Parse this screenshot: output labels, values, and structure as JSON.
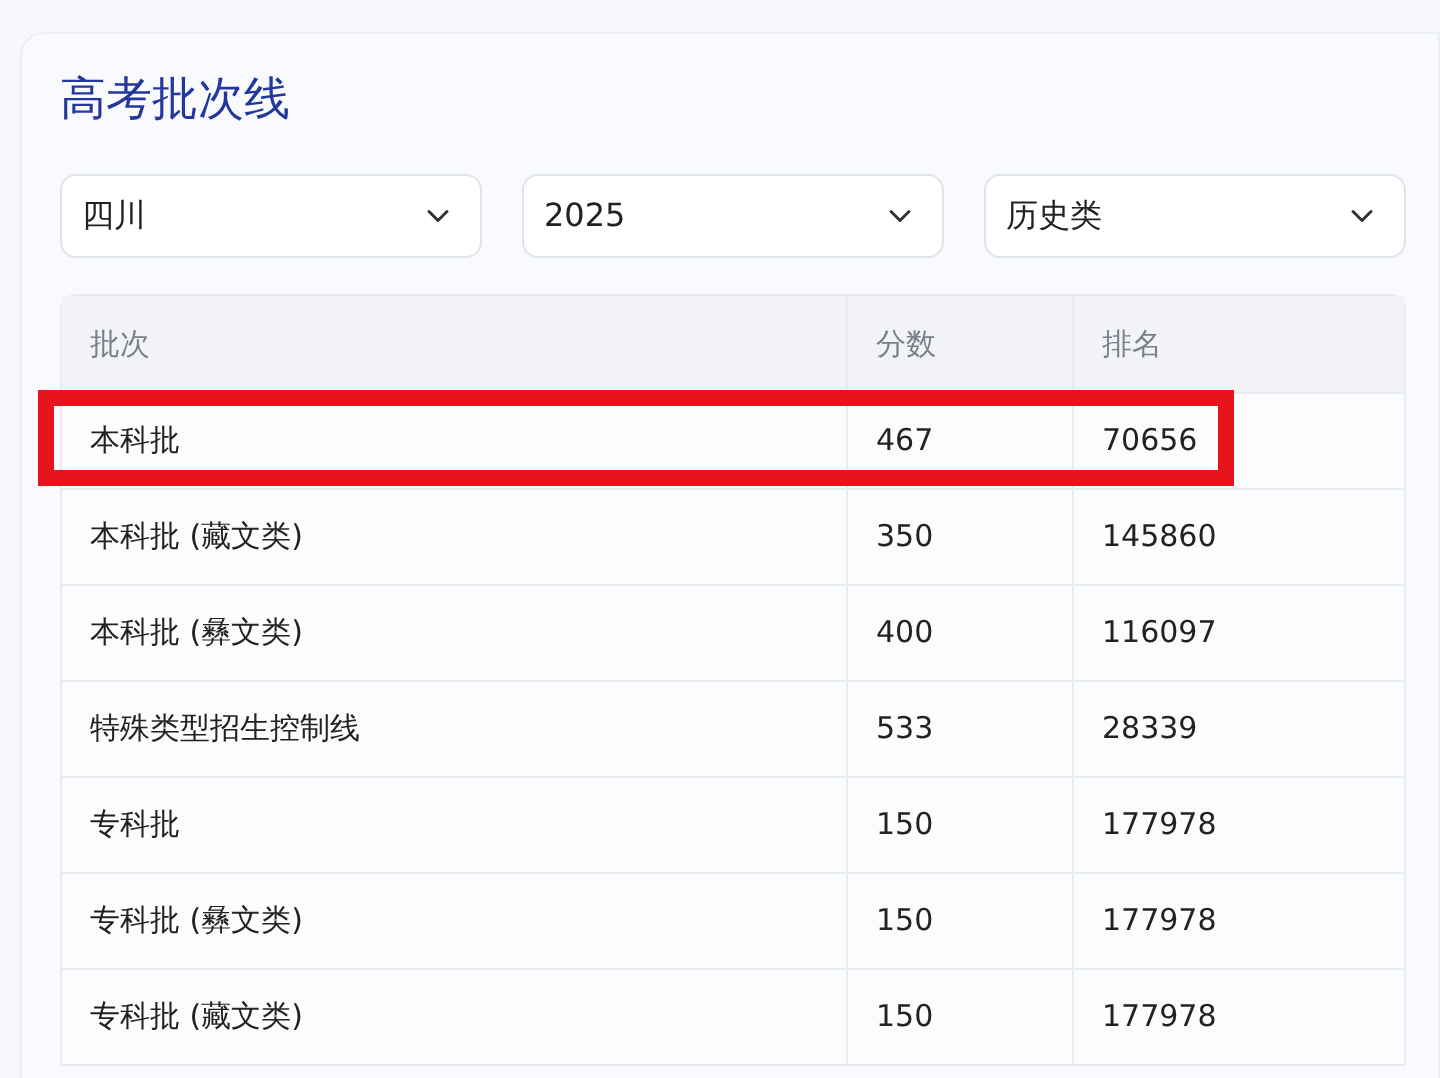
{
  "title": "高考批次线",
  "filters": [
    {
      "value": "四川"
    },
    {
      "value": "2025"
    },
    {
      "value": "历史类"
    }
  ],
  "table": {
    "columns": [
      "批次",
      "分数",
      "排名"
    ],
    "rows": [
      {
        "cells": [
          "本科批",
          "467",
          "70656"
        ],
        "highlighted": true
      },
      {
        "cells": [
          "本科批 (藏文类)",
          "350",
          "145860"
        ],
        "highlighted": false
      },
      {
        "cells": [
          "本科批 (彝文类)",
          "400",
          "116097"
        ],
        "highlighted": false
      },
      {
        "cells": [
          "特殊类型招生控制线",
          "533",
          "28339"
        ],
        "highlighted": false
      },
      {
        "cells": [
          "专科批",
          "150",
          "177978"
        ],
        "highlighted": false
      },
      {
        "cells": [
          "专科批 (彝文类)",
          "150",
          "177978"
        ],
        "highlighted": false
      },
      {
        "cells": [
          "专科批 (藏文类)",
          "150",
          "177978"
        ],
        "highlighted": false
      }
    ]
  }
}
